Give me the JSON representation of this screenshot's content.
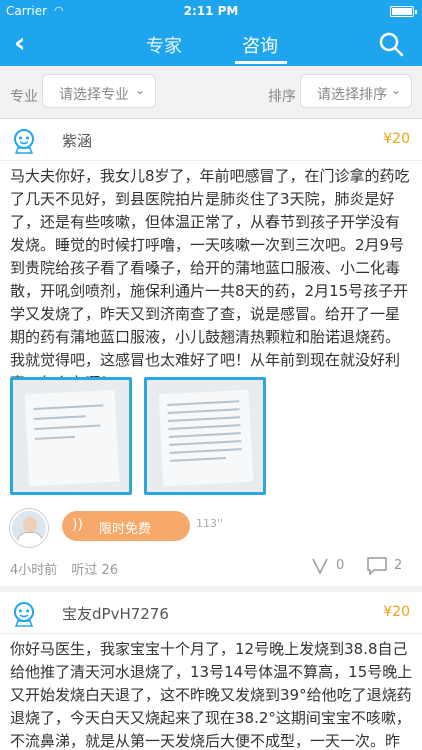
{
  "status": {
    "carrier": "Carrier",
    "time": "2:11 PM"
  },
  "nav": {
    "back_icon": "chevron-left-icon",
    "tabs": [
      "专家",
      "咨询"
    ],
    "active_tab": "咨询",
    "search_icon": "search-icon"
  },
  "filters": {
    "specialty_label": "专业",
    "specialty_placeholder": "请选择专业",
    "sort_label": "排序",
    "sort_placeholder": "请选择排序"
  },
  "posts": [
    {
      "user": "紫涵",
      "price": "¥20",
      "content": "马大夫你好，我女儿8岁了，年前吧感冒了，在门诊拿的药吃了几天不见好，到县医院拍片是肺炎住了3天院，肺炎是好了，还是有些咳嗽，但体温正常了，从春节到孩子开学没有发烧。睡觉的时候打呼噜，一天咳嗽一次到三次吧。2月9号到贵院给孩子看了看嗓子，给开的蒲地蓝口服液、小二化毒散，开吼剑喷剂，施保利通片一共8天的药，2月15号孩子开学又发烧了，昨天又到济南查了查，说是感冒。给开了一星期的药有蒲地蓝口服液，小儿鼓翘清热颗粒和胎诺退烧药。我就觉得吧，这感冒也太难好了吧！从年前到现在就没好利索。怎么办啊？",
      "audio_label": "限时免费",
      "audio_duration": "113''",
      "time": "4小时前",
      "listen": "听过 26",
      "likes": "0",
      "comments": "2"
    },
    {
      "user": "宝友dPvH7276",
      "price": "¥20",
      "content": "你好马医生，我家宝宝十个月了，12号晚上发烧到38.8自己给他推了清天河水退烧了，13号14号体温不算高，15号晚上又开始发烧白天退了，这不昨晚又发烧到39°给他吃了退烧药退烧了，今天白天又烧起来了现在38.2°这期间宝宝不咳嗽，不流鼻涕，就是从第一天发烧后大便不成型，一天一次。昨天在我们这的医院查的血，说是"
    }
  ],
  "colors": {
    "brand": "#1fa5ee",
    "price": "#e8a317",
    "audio": "#f6a96a"
  }
}
